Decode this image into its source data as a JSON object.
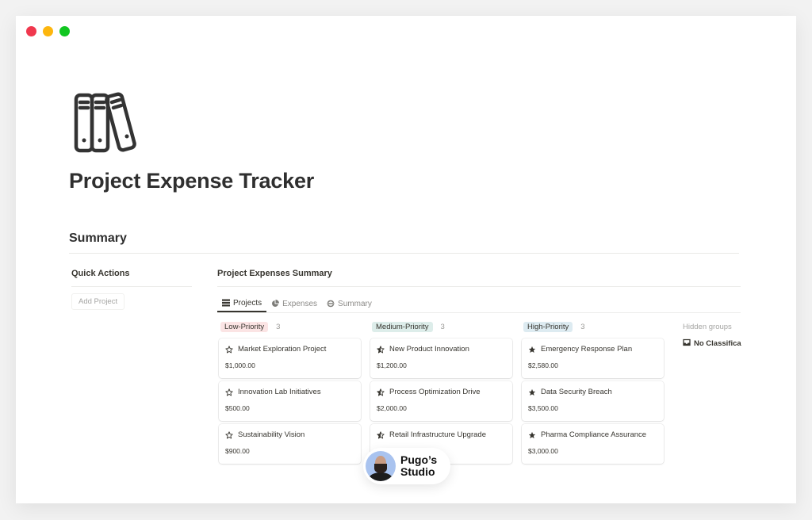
{
  "window": {
    "controls": [
      "close",
      "minimize",
      "maximize"
    ]
  },
  "page": {
    "icon": "books-binders-icon",
    "title": "Project Expense Tracker"
  },
  "section": {
    "title": "Summary"
  },
  "quick_actions": {
    "title": "Quick Actions",
    "buttons": [
      {
        "label": "Add Project"
      }
    ]
  },
  "summary": {
    "title": "Project Expenses Summary",
    "tabs": [
      {
        "label": "Projects",
        "icon": "table-list-icon",
        "active": true
      },
      {
        "label": "Expenses",
        "icon": "pie-chart-icon",
        "active": false
      },
      {
        "label": "Summary",
        "icon": "refresh-cycle-icon",
        "active": false
      }
    ],
    "groups": [
      {
        "label": "Low-Priority",
        "count": "3",
        "color": "#fbe4e4",
        "star_filled": false,
        "cards": [
          {
            "title": "Market Exploration Project",
            "amount": "$1,000.00"
          },
          {
            "title": "Innovation Lab Initiatives",
            "amount": "$500.00"
          },
          {
            "title": "Sustainability Vision",
            "amount": "$900.00"
          }
        ]
      },
      {
        "label": "Medium-Priority",
        "count": "3",
        "color": "#ddedea",
        "star_filled": "half",
        "cards": [
          {
            "title": "New Product Innovation",
            "amount": "$1,200.00"
          },
          {
            "title": "Process Optimization Drive",
            "amount": "$2,000.00"
          },
          {
            "title": "Retail Infrastructure Upgrade",
            "amount": ""
          }
        ]
      },
      {
        "label": "High-Priority",
        "count": "3",
        "color": "#ddebf1",
        "star_filled": true,
        "cards": [
          {
            "title": "Emergency Response Plan",
            "amount": "$2,580.00"
          },
          {
            "title": "Data Security Breach",
            "amount": "$3,500.00"
          },
          {
            "title": "Pharma Compliance Assurance",
            "amount": "$3,000.00"
          }
        ]
      }
    ],
    "hidden_groups": {
      "label": "Hidden groups",
      "items": [
        {
          "label": "No Classifica",
          "icon": "inbox-icon"
        }
      ]
    }
  },
  "watermark": {
    "line1": "Pugo’s",
    "line2": "Studio"
  }
}
